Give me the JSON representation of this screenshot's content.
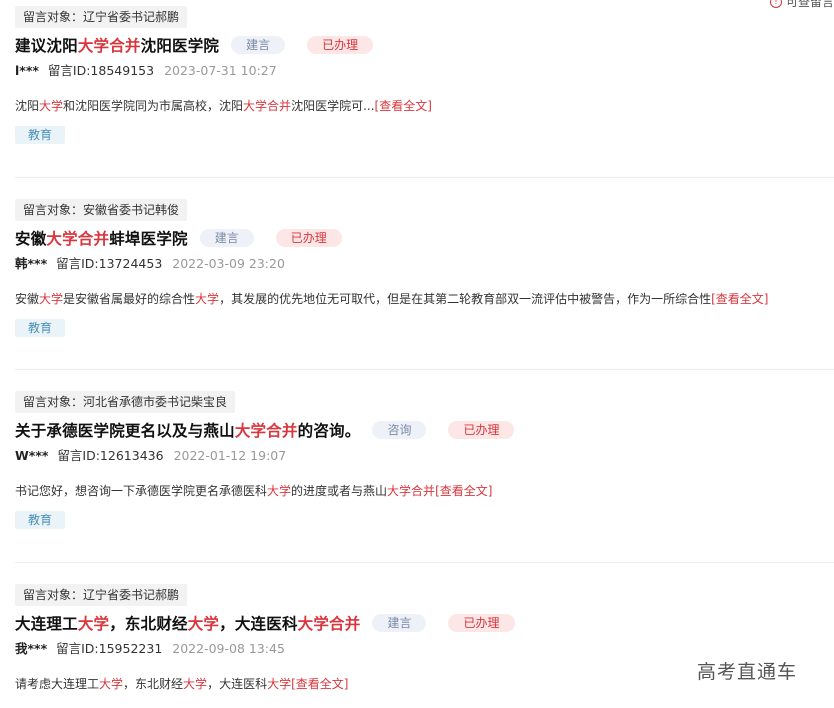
{
  "top_link": {
    "label": "可查留言"
  },
  "watermark": "高考直通车",
  "cards": [
    {
      "target": "留言对象：辽宁省委书记郝鹏",
      "title_parts": [
        "建议沈阳",
        "大学合并",
        "沈阳医学院"
      ],
      "type": "建言",
      "status": "已办理",
      "author": "l***",
      "message_id": "留言ID:18549153",
      "date": "2023-07-31 10:27",
      "summary_parts": [
        "沈阳",
        "大学",
        "和沈阳医学院同为市属高校，沈阳",
        "大学合并",
        "沈阳医学院可..."
      ],
      "more": "[查看全文]",
      "tag": "教育"
    },
    {
      "target": "留言对象：安徽省委书记韩俊",
      "title_parts": [
        "安徽",
        "大学合并",
        "蚌埠医学院"
      ],
      "type": "建言",
      "status": "已办理",
      "author": "韩***",
      "message_id": "留言ID:13724453",
      "date": "2022-03-09 23:20",
      "summary_parts": [
        "安徽",
        "大学",
        "是安徽省属最好的综合性",
        "大学",
        "，其发展的优先地位无可取代，但是在其第二轮教育部双一流评估中被警告，作为一所综合性"
      ],
      "more": "[查看全文]",
      "tag": "教育"
    },
    {
      "target": "留言对象：河北省承德市委书记柴宝良",
      "title_parts": [
        "关于承德医学院更名以及与燕山",
        "大学合并",
        "的咨询。"
      ],
      "type": "咨询",
      "status": "已办理",
      "author": "W***",
      "message_id": "留言ID:12613436",
      "date": "2022-01-12 19:07",
      "summary_parts": [
        "书记您好，想咨询一下承德医学院更名承德医科",
        "大学",
        "的进度或者与燕山",
        "大学合并",
        ""
      ],
      "more": "[查看全文]",
      "tag": "教育"
    },
    {
      "target": "留言对象：辽宁省委书记郝鹏",
      "title_parts": [
        "大连理工",
        "大学",
        "，东北财经",
        "大学",
        "，大连医科",
        "大学合并",
        ""
      ],
      "type": "建言",
      "status": "已办理",
      "author": "我***",
      "message_id": "留言ID:15952231",
      "date": "2022-09-08 13:45",
      "summary_parts": [
        "请考虑大连理工",
        "大学",
        "，东北财经",
        "大学",
        "，大连医科",
        "大学",
        ""
      ],
      "more": "[查看全文]",
      "tag": ""
    }
  ]
}
